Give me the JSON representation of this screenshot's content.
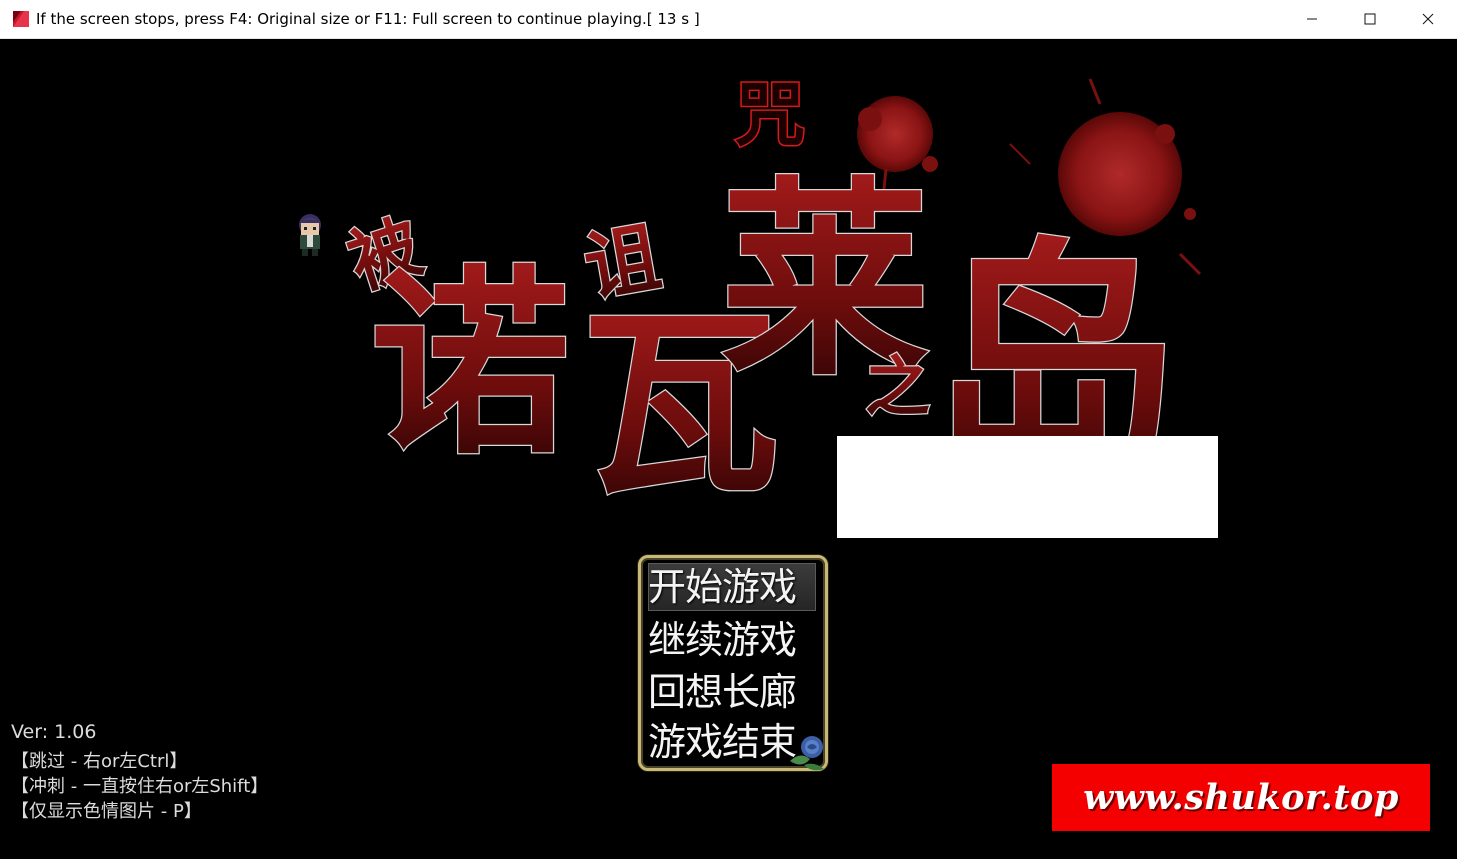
{
  "window": {
    "title": "If the screen stops, press F4: Original size or F11: Full screen to continue playing.[ 13 s ]",
    "minimize_glyph": "—",
    "maximize_glyph": "☐",
    "close_glyph": "✕"
  },
  "logo": {
    "characters": [
      "被",
      "诺",
      "诅",
      "瓦",
      "咒",
      "莱",
      "之",
      "岛"
    ],
    "colors": {
      "blood": "#8b1010",
      "outline": "#d8d8d8",
      "dark": "#3a0505"
    }
  },
  "menu": {
    "items": [
      {
        "label": "开始游戏",
        "selected": true
      },
      {
        "label": "继续游戏",
        "selected": false
      },
      {
        "label": "回想长廊",
        "selected": false
      },
      {
        "label": "游戏结束",
        "selected": false
      }
    ],
    "border_color": "#c8b978"
  },
  "info": {
    "version": "Ver:  1.06",
    "skip_hint": "【跳过 - 右or左Ctrl】",
    "dash_hint": "【冲刺 - 一直按住右or左Shift】",
    "image_hint": "【仅显示色情图片 - P】"
  },
  "watermark": {
    "text": "www.shukor.top",
    "color": "#f40000"
  },
  "icons": [
    "app-icon",
    "minimize-icon",
    "maximize-icon",
    "close-icon",
    "character-sprite",
    "rose-icon"
  ]
}
